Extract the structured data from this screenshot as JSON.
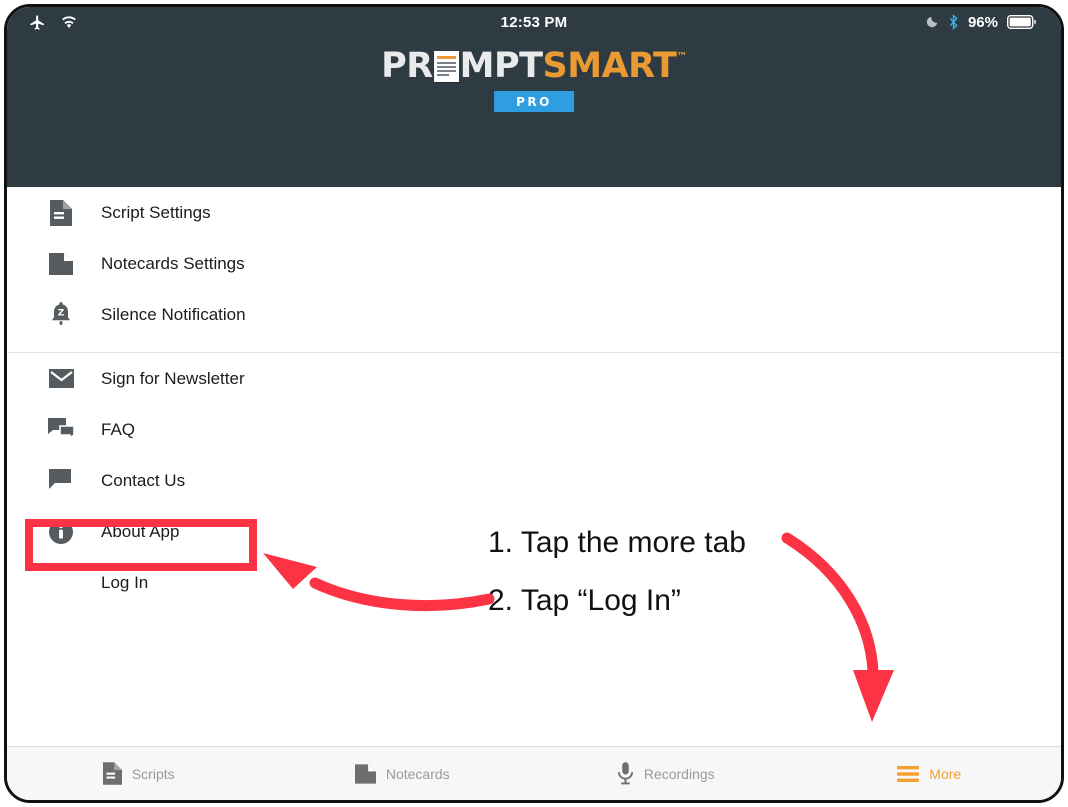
{
  "statusbar": {
    "airplane_icon": "airplane-icon",
    "wifi_icon": "wifi-icon",
    "time": "12:53 PM",
    "dnd_icon": "moon-icon",
    "bluetooth_icon": "bluetooth-icon",
    "battery_percent": "96%",
    "battery_icon": "battery-icon"
  },
  "header": {
    "logo": {
      "part1": "PR",
      "doc_icon": "script-document-icon",
      "part2": "MPT",
      "part3": "SMART",
      "trademark": "™",
      "badge": "PRO"
    }
  },
  "menu": {
    "group1": [
      {
        "label": "Script Settings",
        "icon": "document-icon"
      },
      {
        "label": "Notecards Settings",
        "icon": "notecard-icon"
      },
      {
        "label": "Silence Notification",
        "icon": "bell-silence-icon"
      }
    ],
    "group2": [
      {
        "label": "Sign for Newsletter",
        "icon": "envelope-icon"
      },
      {
        "label": "FAQ",
        "icon": "chat-bubbles-icon"
      },
      {
        "label": "Contact Us",
        "icon": "chat-bubble-icon"
      },
      {
        "label": "About App",
        "icon": "info-circle-icon"
      },
      {
        "label": "Log In",
        "icon": "none"
      }
    ]
  },
  "annotations": {
    "step1": "1. Tap the more tab",
    "step2": "2. Tap “Log In”",
    "arrow_to_login": "curved-arrow-left-icon",
    "arrow_to_more_tab": "curved-arrow-down-icon",
    "highlight_box": "login-highlight-box"
  },
  "tabbar": {
    "tabs": [
      {
        "label": "Scripts",
        "icon": "document-icon",
        "active": false
      },
      {
        "label": "Notecards",
        "icon": "notecard-icon",
        "active": false
      },
      {
        "label": "Recordings",
        "icon": "microphone-icon",
        "active": false
      },
      {
        "label": "More",
        "icon": "hamburger-icon",
        "active": true
      }
    ]
  },
  "colors": {
    "header_bg": "#2e3b43",
    "accent_orange": "#f5a030",
    "logo_orange": "#ea9a33",
    "pro_badge_blue": "#2f9ee0",
    "annotation_red": "#fc3344",
    "tabbar_bg": "#f7f7f7"
  }
}
